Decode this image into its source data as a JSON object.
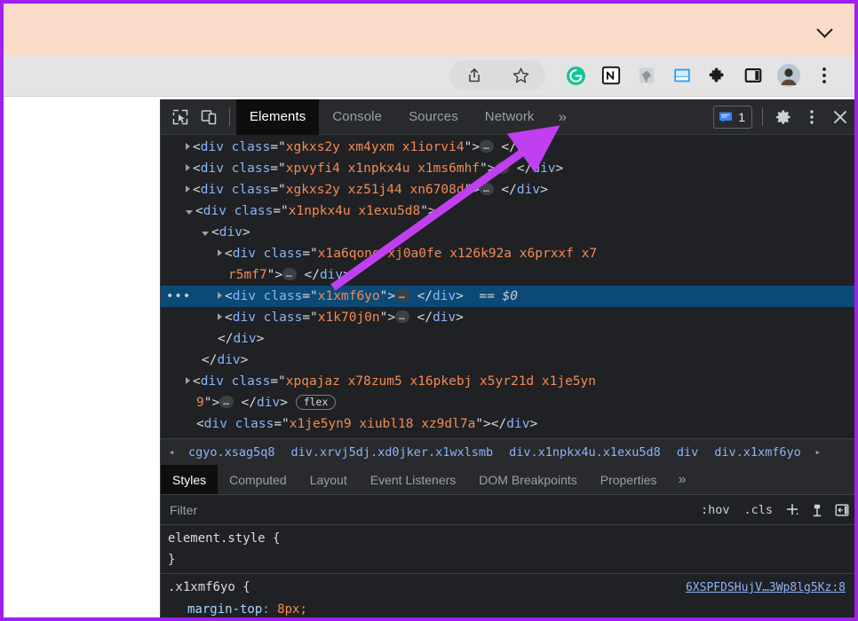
{
  "browser": {
    "page_banner": {
      "chevron_icon": "chevron-down-icon"
    },
    "toolbar_icons": [
      "share-icon",
      "bookmark-star-icon",
      "grammarly-extension-icon",
      "notion-extension-icon",
      "evernote-extension-icon",
      "pocket-extension-icon",
      "extensions-puzzle-icon",
      "side-panel-icon",
      "profile-avatar",
      "chrome-menu-icon"
    ]
  },
  "devtools": {
    "left_tools": [
      "inspect-element-icon",
      "device-toolbar-icon"
    ],
    "tabs": [
      {
        "label": "Elements",
        "active": true
      },
      {
        "label": "Console",
        "active": false
      },
      {
        "label": "Sources",
        "active": false
      },
      {
        "label": "Network",
        "active": false
      }
    ],
    "more_tabs_label": "»",
    "message_count": "1",
    "right_icons": [
      "settings-gear-icon",
      "devtools-menu-icon",
      "close-devtools-icon"
    ],
    "dom_rows": [
      {
        "indent": 28,
        "twisty": "closed",
        "segments": [
          {
            "t": "punc",
            "v": "<"
          },
          {
            "t": "tag",
            "v": "div"
          },
          {
            "t": "punc",
            "v": " "
          },
          {
            "t": "attrname",
            "v": "class"
          },
          {
            "t": "punc",
            "v": "=\""
          },
          {
            "t": "val",
            "v": "xgkxs2y xm4yxm x1iorvi4"
          },
          {
            "t": "punc",
            "v": "\">"
          },
          {
            "t": "pill",
            "v": "…"
          },
          {
            "t": "punc",
            "v": " </"
          },
          {
            "t": "tag",
            "v": "div"
          },
          {
            "t": "punc",
            "v": ">"
          }
        ]
      },
      {
        "indent": 28,
        "twisty": "closed",
        "segments": [
          {
            "t": "punc",
            "v": "<"
          },
          {
            "t": "tag",
            "v": "div"
          },
          {
            "t": "punc",
            "v": " "
          },
          {
            "t": "attrname",
            "v": "class"
          },
          {
            "t": "punc",
            "v": "=\""
          },
          {
            "t": "val",
            "v": "xpvyfi4 x1npkx4u x1ms6mhf"
          },
          {
            "t": "punc",
            "v": "\">"
          },
          {
            "t": "pill",
            "v": "…"
          },
          {
            "t": "punc",
            "v": " </"
          },
          {
            "t": "tag",
            "v": "div"
          },
          {
            "t": "punc",
            "v": ">"
          }
        ]
      },
      {
        "indent": 28,
        "twisty": "closed",
        "segments": [
          {
            "t": "punc",
            "v": "<"
          },
          {
            "t": "tag",
            "v": "div"
          },
          {
            "t": "punc",
            "v": " "
          },
          {
            "t": "attrname",
            "v": "class"
          },
          {
            "t": "punc",
            "v": "=\""
          },
          {
            "t": "val",
            "v": "xgkxs2y xz51j44 xn6708d"
          },
          {
            "t": "punc",
            "v": "\">"
          },
          {
            "t": "pill",
            "v": "…"
          },
          {
            "t": "punc",
            "v": " </"
          },
          {
            "t": "tag",
            "v": "div"
          },
          {
            "t": "punc",
            "v": ">"
          }
        ]
      },
      {
        "indent": 28,
        "twisty": "open",
        "segments": [
          {
            "t": "punc",
            "v": "<"
          },
          {
            "t": "tag",
            "v": "div"
          },
          {
            "t": "punc",
            "v": " "
          },
          {
            "t": "attrname",
            "v": "class"
          },
          {
            "t": "punc",
            "v": "=\""
          },
          {
            "t": "val",
            "v": "x1npkx4u x1exu5d8"
          },
          {
            "t": "punc",
            "v": "\">"
          }
        ]
      },
      {
        "indent": 46,
        "twisty": "open",
        "segments": [
          {
            "t": "punc",
            "v": "<"
          },
          {
            "t": "tag",
            "v": "div"
          },
          {
            "t": "punc",
            "v": ">"
          }
        ]
      },
      {
        "indent": 64,
        "twisty": "closed",
        "segments": [
          {
            "t": "punc",
            "v": "<"
          },
          {
            "t": "tag",
            "v": "div"
          },
          {
            "t": "punc",
            "v": " "
          },
          {
            "t": "attrname",
            "v": "class"
          },
          {
            "t": "punc",
            "v": "=\""
          },
          {
            "t": "val",
            "v": "x1a6qonq xj0a0fe x126k92a x6prxxf x7"
          }
        ]
      },
      {
        "indent": 76,
        "twisty": "none",
        "segments": [
          {
            "t": "val",
            "v": "r5mf7"
          },
          {
            "t": "punc",
            "v": "\">"
          },
          {
            "t": "pill",
            "v": "…"
          },
          {
            "t": "punc",
            "v": " </"
          },
          {
            "t": "tag",
            "v": "div"
          },
          {
            "t": "punc",
            "v": ">"
          }
        ]
      },
      {
        "indent": 64,
        "twisty": "closed",
        "selected": true,
        "segments": [
          {
            "t": "punc",
            "v": "<"
          },
          {
            "t": "tag",
            "v": "div"
          },
          {
            "t": "punc",
            "v": " "
          },
          {
            "t": "attrname",
            "v": "class"
          },
          {
            "t": "punc",
            "v": "=\""
          },
          {
            "t": "val",
            "v": "x1xmf6yo"
          },
          {
            "t": "punc",
            "v": "\">"
          },
          {
            "t": "pill",
            "v": "…"
          },
          {
            "t": "punc",
            "v": " </"
          },
          {
            "t": "tag",
            "v": "div"
          },
          {
            "t": "punc",
            "v": ">"
          },
          {
            "t": "dollar",
            "v": "  == $0"
          }
        ]
      },
      {
        "indent": 64,
        "twisty": "closed",
        "segments": [
          {
            "t": "punc",
            "v": "<"
          },
          {
            "t": "tag",
            "v": "div"
          },
          {
            "t": "punc",
            "v": " "
          },
          {
            "t": "attrname",
            "v": "class"
          },
          {
            "t": "punc",
            "v": "=\""
          },
          {
            "t": "val",
            "v": "x1k70j0n"
          },
          {
            "t": "punc",
            "v": "\">"
          },
          {
            "t": "pill",
            "v": "…"
          },
          {
            "t": "punc",
            "v": " </"
          },
          {
            "t": "tag",
            "v": "div"
          },
          {
            "t": "punc",
            "v": ">"
          }
        ]
      },
      {
        "indent": 64,
        "twisty": "none",
        "segments": [
          {
            "t": "punc",
            "v": "</"
          },
          {
            "t": "tag",
            "v": "div"
          },
          {
            "t": "punc",
            "v": ">"
          }
        ]
      },
      {
        "indent": 46,
        "twisty": "none",
        "segments": [
          {
            "t": "punc",
            "v": "</"
          },
          {
            "t": "tag",
            "v": "div"
          },
          {
            "t": "punc",
            "v": ">"
          }
        ]
      },
      {
        "indent": 28,
        "twisty": "closed",
        "segments": [
          {
            "t": "punc",
            "v": "<"
          },
          {
            "t": "tag",
            "v": "div"
          },
          {
            "t": "punc",
            "v": " "
          },
          {
            "t": "attrname",
            "v": "class"
          },
          {
            "t": "punc",
            "v": "=\""
          },
          {
            "t": "val",
            "v": "xpqajaz x78zum5 x16pkebj x5yr21d x1je5yn"
          }
        ]
      },
      {
        "indent": 40,
        "twisty": "none",
        "segments": [
          {
            "t": "val",
            "v": "9"
          },
          {
            "t": "punc",
            "v": "\">"
          },
          {
            "t": "pill",
            "v": "…"
          },
          {
            "t": "punc",
            "v": " </"
          },
          {
            "t": "tag",
            "v": "div"
          },
          {
            "t": "punc",
            "v": "> "
          },
          {
            "t": "flex",
            "v": "flex"
          }
        ]
      },
      {
        "indent": 40,
        "twisty": "none",
        "segments": [
          {
            "t": "punc",
            "v": "<"
          },
          {
            "t": "tag",
            "v": "div"
          },
          {
            "t": "punc",
            "v": " "
          },
          {
            "t": "attrname",
            "v": "class"
          },
          {
            "t": "punc",
            "v": "=\""
          },
          {
            "t": "val",
            "v": "x1je5yn9 xiubl18 xz9dl7a"
          },
          {
            "t": "punc",
            "v": "\"></"
          },
          {
            "t": "tag",
            "v": "div"
          },
          {
            "t": "punc",
            "v": ">"
          }
        ]
      },
      {
        "indent": 28,
        "twisty": "none",
        "segments": [
          {
            "t": "punc",
            "v": "</"
          },
          {
            "t": "tag",
            "v": "div"
          },
          {
            "t": "punc",
            "v": ">"
          }
        ]
      }
    ],
    "breadcrumbs": [
      "◂",
      "cgyo.xsag5q8",
      "div.xrvj5dj.xd0jker.x1wxlsmb",
      "div.x1npkx4u.x1exu5d8",
      "div",
      "div.x1xmf6yo",
      "▸"
    ],
    "styles_tabs": [
      {
        "label": "Styles",
        "active": true
      },
      {
        "label": "Computed",
        "active": false
      },
      {
        "label": "Layout",
        "active": false
      },
      {
        "label": "Event Listeners",
        "active": false
      },
      {
        "label": "DOM Breakpoints",
        "active": false
      },
      {
        "label": "Properties",
        "active": false
      }
    ],
    "styles_more_label": "»",
    "filter": {
      "placeholder": "Filter",
      "value": "",
      "hov_label": ":hov",
      "cls_label": ".cls",
      "plus_label": "+",
      "icons": [
        "new-style-rule-icon",
        "computed-sidebar-toggle-icon"
      ]
    },
    "rules": [
      {
        "selector": "element.style {",
        "source": "",
        "close": "}",
        "props": []
      },
      {
        "selector": ".x1xmf6yo {",
        "source": "6XSPFDSHujV…3Wp8lg5Kz:8",
        "close": "",
        "props": [
          {
            "name": "margin-top",
            "value": "8px;"
          }
        ]
      }
    ]
  },
  "annotation": {
    "arrow_color": "#c13ff0",
    "frame_color": "#a21ff0"
  }
}
